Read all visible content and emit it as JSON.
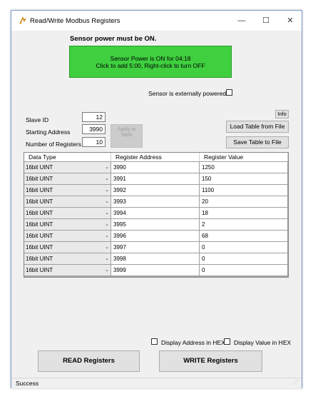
{
  "window": {
    "title": "Read/Write Modbus Registers",
    "minimize": "—",
    "maximize": "☐",
    "close": "✕"
  },
  "power": {
    "warning": "Sensor power must be ON.",
    "button_line1": "Sensor Power is ON for 04:18",
    "button_line2": "Click to add 5:00, Right-click to turn OFF",
    "external_label": "Sensor is externally powered.",
    "external_checked": false,
    "button_color": "#3fcf3f"
  },
  "form": {
    "slave_id_label": "Slave ID",
    "slave_id_value": "12",
    "start_label": "Starting Address",
    "start_value": "3990",
    "count_label": "Number of Registers",
    "count_value": "10",
    "apply_label_1": "Apply to",
    "apply_label_2": "Table",
    "info_label": "Info",
    "load_label": "Load Table from File",
    "save_label": "Save Table to File"
  },
  "table": {
    "headers": [
      "Data Type",
      "Register Address",
      "Register Value"
    ],
    "rows": [
      {
        "type": "16bit UINT",
        "address": "3990",
        "value": "1250"
      },
      {
        "type": "16bit UINT",
        "address": "3991",
        "value": "150"
      },
      {
        "type": "16bit UINT",
        "address": "3992",
        "value": "1100"
      },
      {
        "type": "16bit UINT",
        "address": "3993",
        "value": "20"
      },
      {
        "type": "16bit UINT",
        "address": "3994",
        "value": "18"
      },
      {
        "type": "16bit UINT",
        "address": "3995",
        "value": "2"
      },
      {
        "type": "16bit UINT",
        "address": "3996",
        "value": "68"
      },
      {
        "type": "16bit UINT",
        "address": "3997",
        "value": "0"
      },
      {
        "type": "16bit UINT",
        "address": "3998",
        "value": "0"
      },
      {
        "type": "16bit UINT",
        "address": "3999",
        "value": "0"
      }
    ]
  },
  "options": {
    "hex_address_label": "Display Address in HEX",
    "hex_value_label": "Display Value in HEX"
  },
  "actions": {
    "read_label": "READ Registers",
    "write_label": "WRITE Registers"
  },
  "status": {
    "text": "Success"
  }
}
